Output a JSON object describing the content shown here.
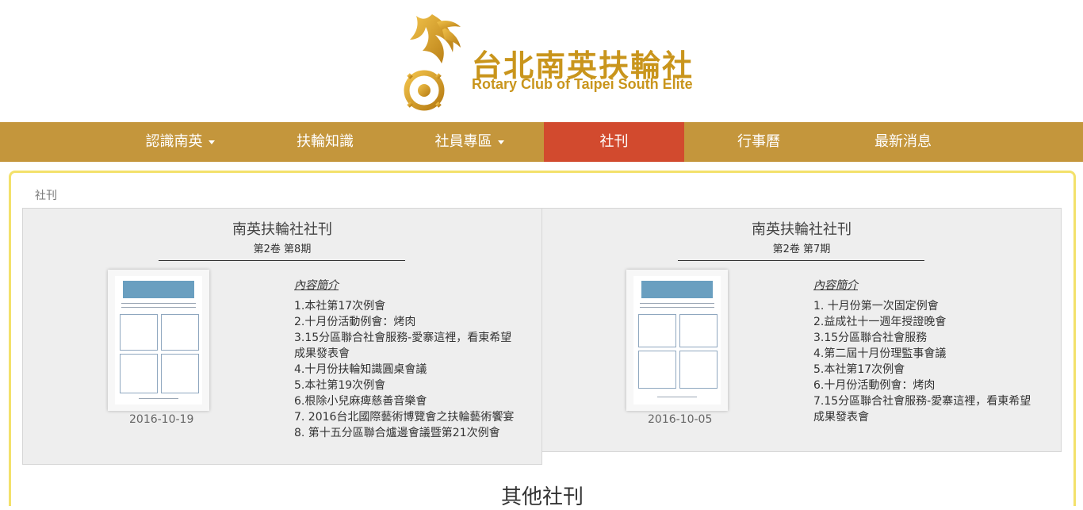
{
  "logo": {
    "name_zh": "台北南英扶輪社",
    "name_en": "Rotary Club of Taipei South Elite"
  },
  "nav": {
    "items": [
      {
        "label": "認識南英"
      },
      {
        "label": "扶輪知識"
      },
      {
        "label": "社員專區"
      },
      {
        "label": "社刊"
      },
      {
        "label": "行事曆"
      },
      {
        "label": "最新消息"
      }
    ]
  },
  "breadcrumb": "社刊",
  "issues": [
    {
      "title": "南英扶輪社社刊",
      "volume": "第2卷 第8期",
      "date": "2016-10-19",
      "summary_title": "內容簡介",
      "items": [
        "1.本社第17次例會",
        "2.十月份活動例會：烤肉",
        "3.15分區聯合社會服務-愛寨這裡，看東希望",
        "成果發表會",
        "4.十月份扶輪知識圓桌會議",
        "5.本社第19次例會",
        "6.根除小兒麻痺慈善音樂會",
        "7. 2016台北國際藝術博覽會之扶輪藝術饗宴",
        "8. 第十五分區聯合爐邊會議暨第21次例會"
      ]
    },
    {
      "title": "南英扶輪社社刊",
      "volume": "第2卷 第7期",
      "date": "2016-10-05",
      "summary_title": "內容簡介",
      "items": [
        "1. 十月份第一次固定例會",
        "2.益成社十一週年授證晚會",
        "3.15分區聯合社會服務",
        "4.第二屆十月份理監事會議",
        "5.本社第17次例會",
        "6.十月份活動例會：烤肉",
        "7.15分區聯合社會服務-愛寨這裡，看東希望",
        "成果發表會"
      ]
    }
  ],
  "other_title": "其他社刊",
  "colors": {
    "nav_bg": "#c4963c",
    "nav_active": "#d24a2e",
    "logo_gold": "#c9951c",
    "frame_border": "#f3e16b"
  }
}
